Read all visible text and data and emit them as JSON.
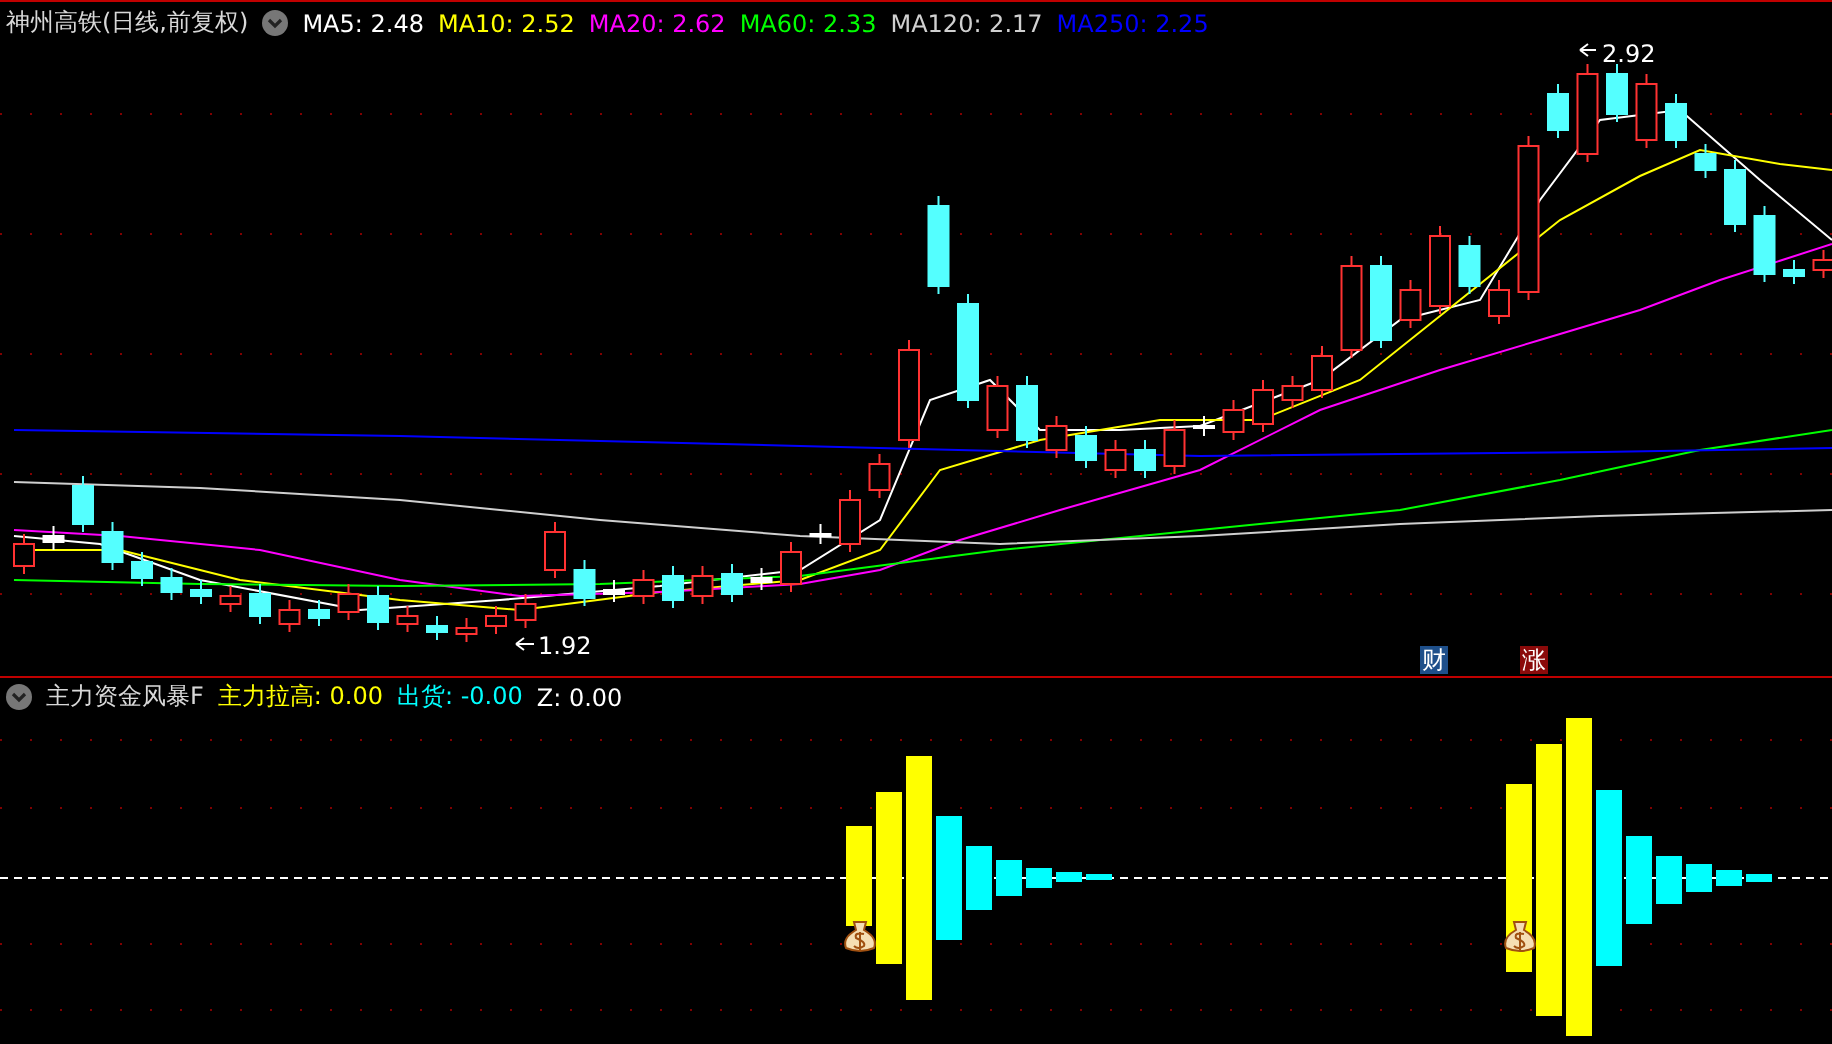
{
  "main_panel": {
    "title": "神州高铁(日线,前复权)",
    "indicators": [
      {
        "text": "MA5: 2.48",
        "color": "#ffffff"
      },
      {
        "text": "MA10: 2.52",
        "color": "#ffff00"
      },
      {
        "text": "MA20: 2.62",
        "color": "#ff00ff"
      },
      {
        "text": "MA60: 2.33",
        "color": "#00ff00"
      },
      {
        "text": "MA120: 2.17",
        "color": "#d0d0d0"
      },
      {
        "text": "MA250: 2.25",
        "color": "#0000ff"
      }
    ],
    "high_label": "2.92",
    "low_label": "1.92",
    "badges": [
      {
        "text": "财",
        "color": "#1e4f8a"
      },
      {
        "text": "涨",
        "color": "#8b0a0a"
      }
    ]
  },
  "sub_panel": {
    "title": "主力资金风暴F",
    "indicators": [
      {
        "text": "主力拉高: 0.00",
        "color": "#ffff00"
      },
      {
        "text": "出货: -0.00",
        "color": "#00ffff"
      },
      {
        "text": "Z: 0.00",
        "color": "#ffffff"
      }
    ]
  }
}
